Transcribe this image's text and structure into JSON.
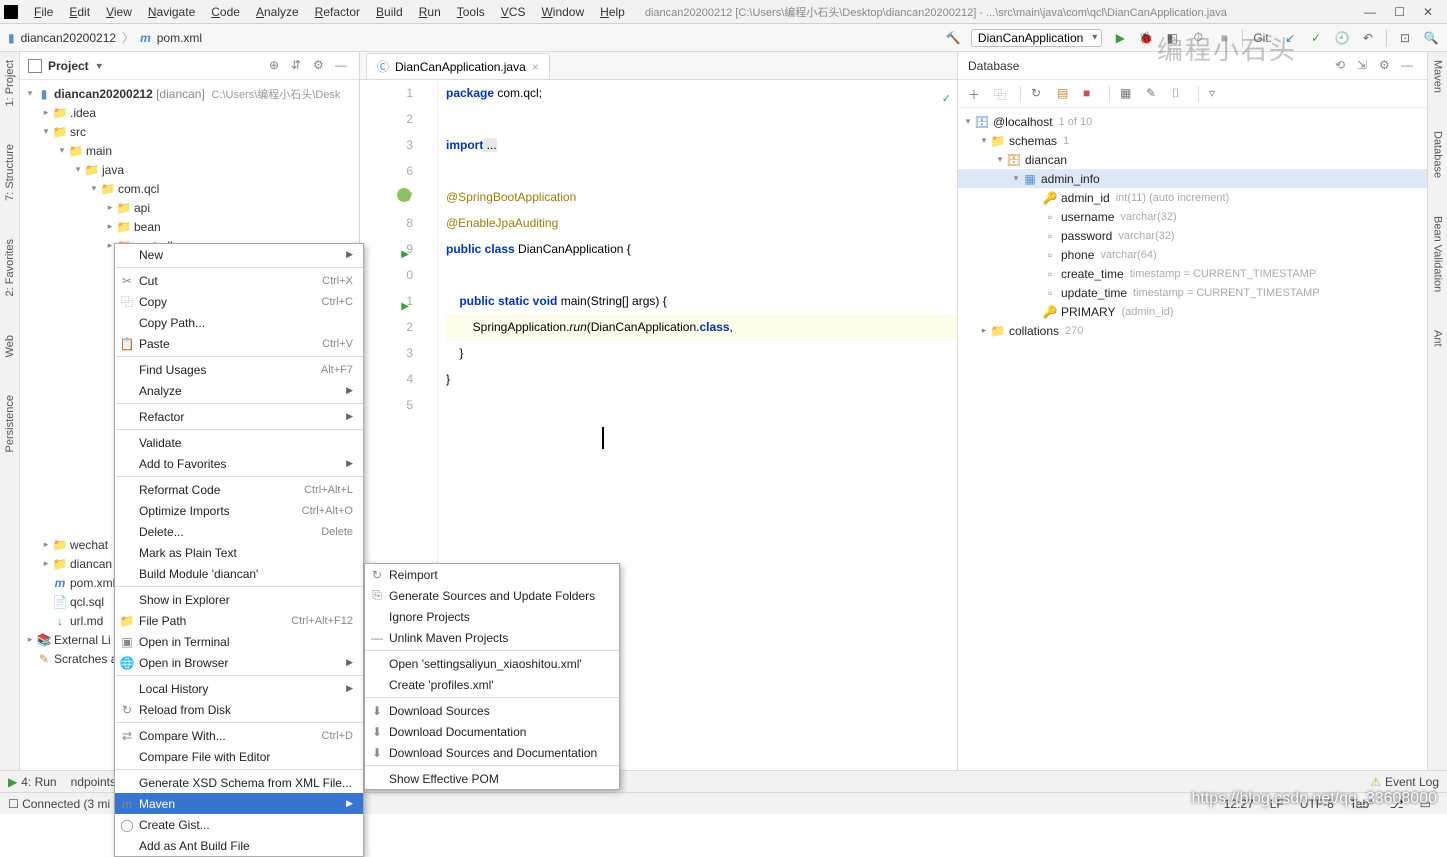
{
  "menubar": {
    "items": [
      "File",
      "Edit",
      "View",
      "Navigate",
      "Code",
      "Analyze",
      "Refactor",
      "Build",
      "Run",
      "Tools",
      "VCS",
      "Window",
      "Help"
    ],
    "title_path": "diancan20200212 [C:\\Users\\编程小石头\\Desktop\\diancan20200212] - ...\\src\\main\\java\\com\\qcl\\DianCanApplication.java"
  },
  "breadcrumb": {
    "project": "diancan20200212",
    "file": "pom.xml"
  },
  "run_config": "DianCanApplication",
  "git_label": "Git:",
  "project_panel": {
    "title": "Project",
    "root": {
      "name": "diancan20200212",
      "mod": "[diancan]",
      "path": "C:\\Users\\编程小石头\\Desk"
    },
    "idea": ".idea",
    "src": "src",
    "main": "main",
    "java": "java",
    "pkg": "com.qcl",
    "api": "api",
    "bean": "bean",
    "controller": "controller",
    "wechat": "wechat",
    "diancan_folder": "diancan",
    "pom": "pom.xml",
    "qcl_sql": "qcl.sql",
    "url_md": "url.md",
    "ext_libs": "External Li",
    "scratches": "Scratches a"
  },
  "editor": {
    "tab": "DianCanApplication.java",
    "lines": {
      "l1a": "package",
      "l1b": " com.qcl;",
      "l3a": "import",
      "l3b": " ...",
      "l7": "@SpringBootApplication",
      "l8": "@EnableJpaAuditing",
      "l9a": "public class",
      "l9b": " DianCanApplication {",
      "l11a": "    public static void",
      "l11b": " main(String[] args) {",
      "l12a": "        SpringApplication.",
      "l12b": "run",
      "l12c": "(DianCanApplication.",
      "l12d": "class",
      "l12e": ",",
      "l13": "    }",
      "l14": "}"
    },
    "gutter_numbers": [
      "1",
      "2",
      "3",
      "6",
      "7",
      "8",
      "9",
      "0",
      "1",
      "2",
      "3",
      "4",
      "5"
    ]
  },
  "ctx_main": [
    {
      "label": "New",
      "sub": true
    },
    {
      "sep": true
    },
    {
      "label": "Cut",
      "sc": "Ctrl+X",
      "icon": "✂"
    },
    {
      "label": "Copy",
      "sc": "Ctrl+C",
      "icon": "⿻"
    },
    {
      "label": "Copy Path...",
      "icon": ""
    },
    {
      "label": "Paste",
      "sc": "Ctrl+V",
      "icon": "📋"
    },
    {
      "sep": true
    },
    {
      "label": "Find Usages",
      "sc": "Alt+F7"
    },
    {
      "label": "Analyze",
      "sub": true
    },
    {
      "sep": true
    },
    {
      "label": "Refactor",
      "sub": true
    },
    {
      "sep": true
    },
    {
      "label": "Validate"
    },
    {
      "label": "Add to Favorites",
      "sub": true
    },
    {
      "sep": true
    },
    {
      "label": "Reformat Code",
      "sc": "Ctrl+Alt+L"
    },
    {
      "label": "Optimize Imports",
      "sc": "Ctrl+Alt+O"
    },
    {
      "label": "Delete...",
      "sc": "Delete"
    },
    {
      "label": "Mark as Plain Text"
    },
    {
      "label": "Build Module 'diancan'"
    },
    {
      "sep": true
    },
    {
      "label": "Show in Explorer"
    },
    {
      "label": "File Path",
      "sc": "Ctrl+Alt+F12",
      "icon": "📁"
    },
    {
      "label": "Open in Terminal",
      "icon": "▣"
    },
    {
      "label": "Open in Browser",
      "sub": true,
      "icon": "🌐"
    },
    {
      "sep": true
    },
    {
      "label": "Local History",
      "sub": true
    },
    {
      "label": "Reload from Disk",
      "icon": "↻"
    },
    {
      "sep": true
    },
    {
      "label": "Compare With...",
      "sc": "Ctrl+D",
      "icon": "⇄"
    },
    {
      "label": "Compare File with Editor"
    },
    {
      "sep": true
    },
    {
      "label": "Generate XSD Schema from XML File..."
    },
    {
      "label": "Maven",
      "sub": true,
      "hl": true,
      "icon": "m"
    },
    {
      "label": "Create Gist...",
      "icon": "◯"
    },
    {
      "label": "Add as Ant Build File"
    }
  ],
  "ctx_maven": [
    {
      "label": "Reimport",
      "icon": "↻"
    },
    {
      "label": "Generate Sources and Update Folders",
      "icon": "⎘"
    },
    {
      "label": "Ignore Projects"
    },
    {
      "label": "Unlink Maven Projects",
      "icon": "—"
    },
    {
      "sep": true
    },
    {
      "label": "Open 'settingsaliyun_xiaoshitou.xml'"
    },
    {
      "label": "Create 'profiles.xml'"
    },
    {
      "sep": true
    },
    {
      "label": "Download Sources",
      "icon": "⬇"
    },
    {
      "label": "Download Documentation",
      "icon": "⬇"
    },
    {
      "label": "Download Sources and Documentation",
      "icon": "⬇"
    },
    {
      "sep": true
    },
    {
      "label": "Show Effective POM"
    }
  ],
  "database": {
    "title": "Database",
    "conn": "@localhost",
    "conn_meta": "1 of 10",
    "schemas": "schemas",
    "schemas_meta": "1",
    "db": "diancan",
    "table": "admin_info",
    "cols": [
      {
        "name": "admin_id",
        "meta": "int(11) (auto increment)",
        "key": true
      },
      {
        "name": "username",
        "meta": "varchar(32)"
      },
      {
        "name": "password",
        "meta": "varchar(32)"
      },
      {
        "name": "phone",
        "meta": "varchar(64)"
      },
      {
        "name": "create_time",
        "meta": "timestamp = CURRENT_TIMESTAMP"
      },
      {
        "name": "update_time",
        "meta": "timestamp = CURRENT_TIMESTAMP"
      },
      {
        "name": "PRIMARY",
        "meta": "(admin_id)",
        "key": true
      }
    ],
    "collations": "collations",
    "collations_meta": "270"
  },
  "bottom_tools": {
    "run": "4: Run",
    "connected": "Connected (3 mi",
    "endpoints": "ndpoints",
    "event_log": "Event Log"
  },
  "status": {
    "pos": "12:27",
    "enc": "LF",
    "charset": "UTF-8",
    "tab": "Tab*",
    "branch_icon": "⎇"
  },
  "left_tools": [
    "1: Project",
    "7: Structure",
    "2: Favorites",
    "Web",
    "Persistence"
  ],
  "right_tools": [
    "Maven",
    "Database",
    "Bean Validation",
    "Ant"
  ],
  "watermark1": "编程小石头",
  "watermark2": "https://blog.csdn.net/qq_33608000"
}
